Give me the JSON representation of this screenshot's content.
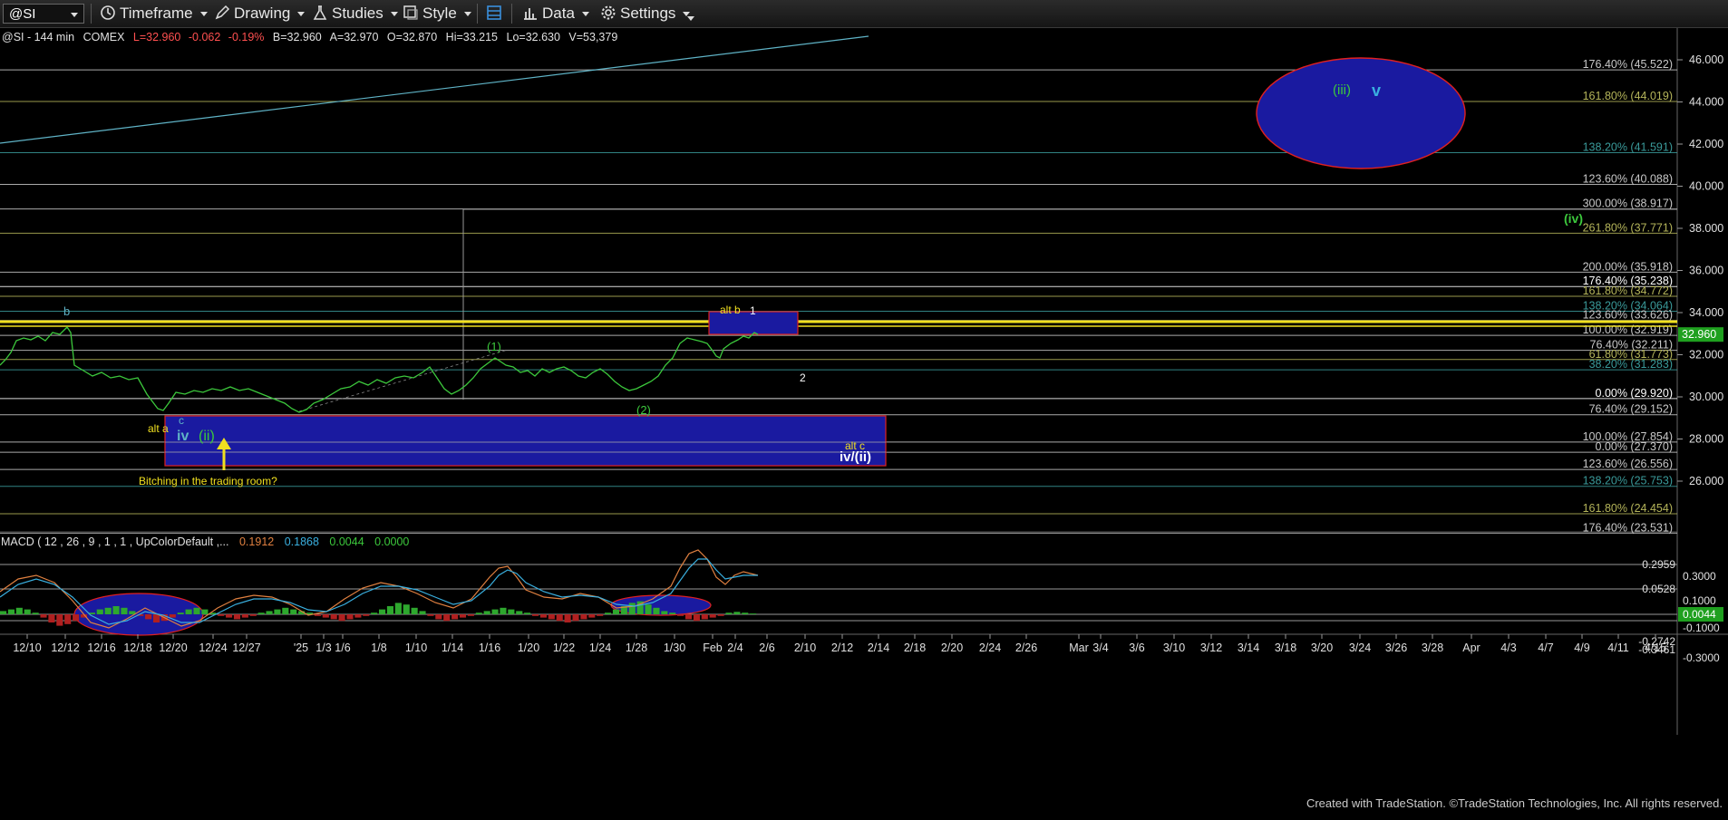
{
  "toolbar": {
    "symbol": "@SI",
    "timeframe": "Timeframe",
    "drawing": "Drawing",
    "studies": "Studies",
    "style": "Style",
    "data": "Data",
    "settings": "Settings"
  },
  "header": {
    "symbol_info": "@SI - 144 min",
    "exchange": "COMEX",
    "last": "L=32.960",
    "change": "-0.062",
    "change_pct": "-0.19%",
    "bid": "B=32.960",
    "ask": "A=32.970",
    "open": "O=32.870",
    "high": "Hi=33.215",
    "low": "Lo=32.630",
    "volume": "V=53,379"
  },
  "price_axis": {
    "ticks": [
      "46.000",
      "44.000",
      "42.000",
      "40.000",
      "38.000",
      "36.000",
      "34.000",
      "32.000",
      "30.000",
      "28.000",
      "26.000"
    ],
    "current_price": "32.960",
    "current_price_color": "#1fa01f"
  },
  "fib_labels": [
    {
      "text": "176.40% (45.522)",
      "value": 45.522,
      "color": "#c8c8c8"
    },
    {
      "text": "161.80% (44.019)",
      "value": 44.019,
      "color": "#b5b55a"
    },
    {
      "text": "138.20% (41.591)",
      "value": 41.591,
      "color": "#3a9a9a"
    },
    {
      "text": "123.60% (40.088)",
      "value": 40.088,
      "color": "#c8c8c8"
    },
    {
      "text": "300.00% (38.917)",
      "value": 38.917,
      "color": "#c8c8c8"
    },
    {
      "text": "261.80% (37.771)",
      "value": 37.771,
      "color": "#b5b55a"
    },
    {
      "text": "200.00% (35.918)",
      "value": 35.918,
      "color": "#c8c8c8"
    },
    {
      "text": "176.40% (35.238)",
      "value": 35.238,
      "color": "#ffffff"
    },
    {
      "text": "161.80% (34.772)",
      "value": 34.772,
      "color": "#b5b55a"
    },
    {
      "text": "138.20% (34.064)",
      "value": 34.064,
      "color": "#3a9a9a"
    },
    {
      "text": "123.60% (33.626)",
      "value": 33.626,
      "color": "#c8c8c8"
    },
    {
      "text": "100.00% (32.919)",
      "value": 32.919,
      "color": "#c8c8c8"
    },
    {
      "text": "76.40% (32.211)",
      "value": 32.211,
      "color": "#c8c8c8"
    },
    {
      "text": "61.80% (31.773)",
      "value": 31.773,
      "color": "#b5b55a"
    },
    {
      "text": "38.20% (31.283)",
      "value": 31.283,
      "color": "#3a9a9a"
    },
    {
      "text": "0.00% (29.920)",
      "value": 29.92,
      "color": "#ffffff"
    },
    {
      "text": "76.40% (29.152)",
      "value": 29.152,
      "color": "#c8c8c8"
    },
    {
      "text": "100.00% (27.854)",
      "value": 27.854,
      "color": "#c8c8c8"
    },
    {
      "text": "0.00% (27.370)",
      "value": 27.37,
      "color": "#c8c8c8"
    },
    {
      "text": "123.60% (26.556)",
      "value": 26.556,
      "color": "#c8c8c8"
    },
    {
      "text": "138.20% (25.753)",
      "value": 25.753,
      "color": "#3a9a9a"
    },
    {
      "text": "161.80% (24.454)",
      "value": 24.454,
      "color": "#b5b55a"
    },
    {
      "text": "176.40% (23.531)",
      "value": 23.531,
      "color": "#c8c8c8"
    }
  ],
  "wave_labels": {
    "b": "b",
    "alt_a": "alt a",
    "c": "c",
    "iv": "iv",
    "ii_paren": "(ii)",
    "one_paren": "(1)",
    "two_paren": "(2)",
    "alt_b": "alt b",
    "one": "1",
    "two": "2",
    "alt_c": "alt c",
    "iv_ii": "iv/(ii)",
    "iii_paren": "(iii)",
    "v": "v",
    "iv_paren": "(iv)"
  },
  "annotation": "Bitching in the trading room?",
  "macd": {
    "title": "MACD ( 12 , 26 , 9 , 1 , 1 , UpColorDefault ,...",
    "macd_value": "0.1912",
    "signal_value": "0.1868",
    "hist_value": "0.0044",
    "zero_value": "0.0000",
    "axis_labels": [
      "0.2959",
      "0.3000",
      "0.0528",
      "0.1000",
      "0.0044",
      "-0.1000",
      "-0.2742",
      "-0.3461",
      "-0.3000"
    ]
  },
  "time_axis": [
    "12/10",
    "12/12",
    "12/16",
    "12/18",
    "12/20",
    "12/24",
    "12/27",
    "'25",
    "1/3",
    "1/6",
    "1/8",
    "1/10",
    "1/14",
    "1/16",
    "1/20",
    "1/22",
    "1/24",
    "1/28",
    "1/30",
    "Feb",
    "2/4",
    "2/6",
    "2/10",
    "2/12",
    "2/14",
    "2/18",
    "2/20",
    "2/24",
    "2/26",
    "Mar",
    "3/4",
    "3/6",
    "3/10",
    "3/12",
    "3/14",
    "3/18",
    "3/20",
    "3/24",
    "3/26",
    "3/28",
    "Apr",
    "4/3",
    "4/7",
    "4/9",
    "4/11",
    "4/15"
  ],
  "footer": "Created with TradeStation. ©TradeStation Technologies, Inc. All rights reserved."
}
